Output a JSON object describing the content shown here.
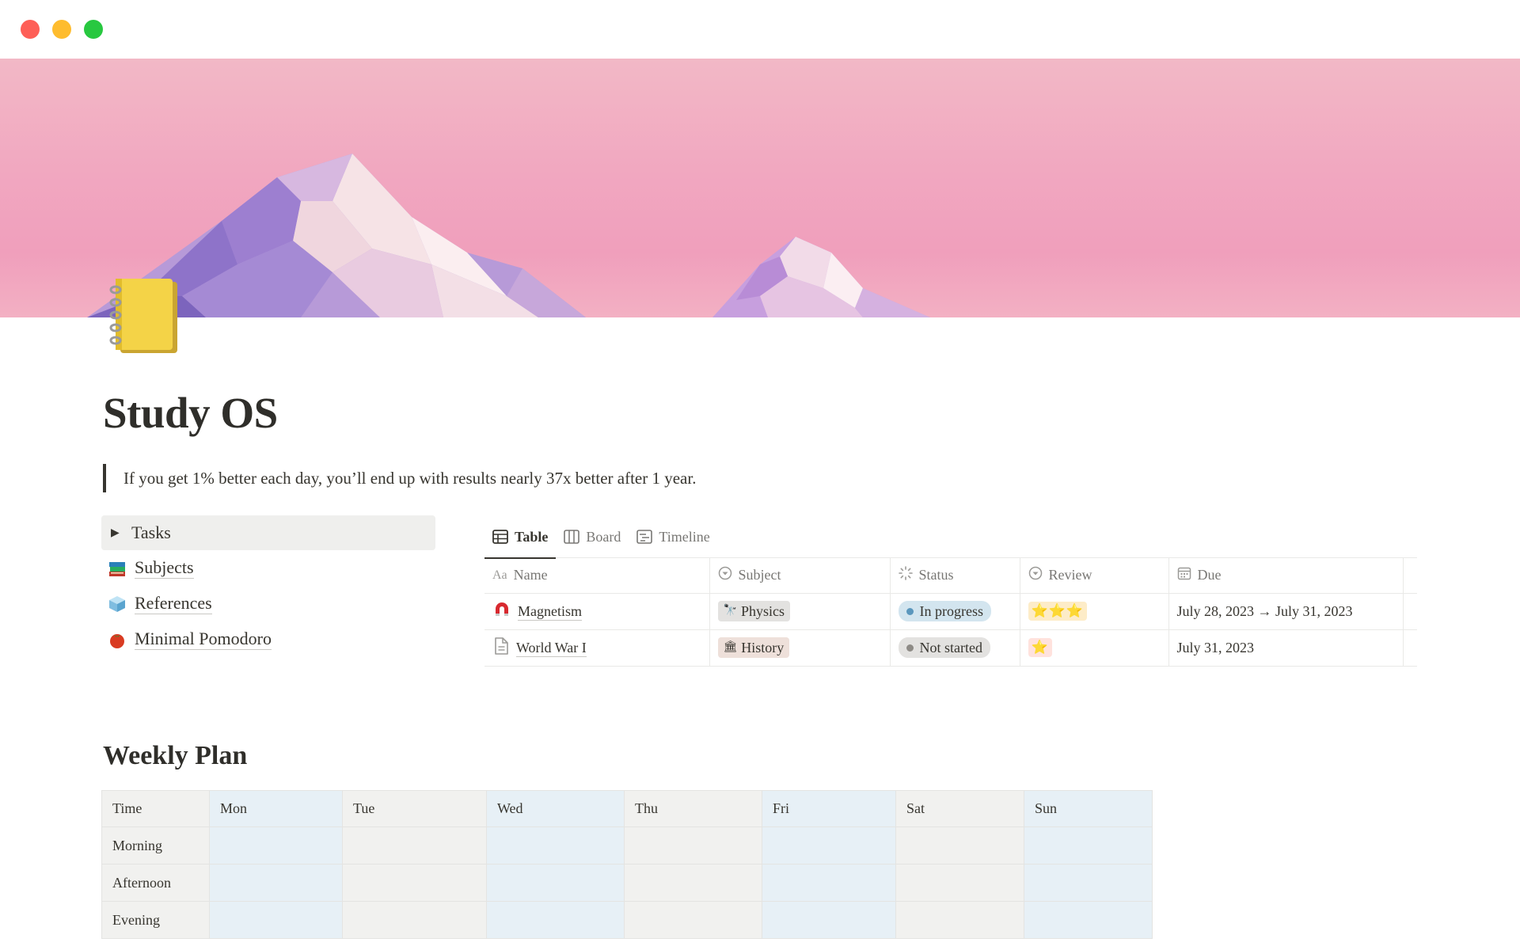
{
  "page": {
    "title": "Study OS",
    "icon": "notebook-icon",
    "quote": "If you get 1% better each day, you’ll end up with results nearly 37x better after 1 year."
  },
  "links": {
    "toggle": {
      "label": "Tasks",
      "icon": "triangle-right-icon"
    },
    "items": [
      {
        "label": "Subjects",
        "icon": "books-icon"
      },
      {
        "label": "References",
        "icon": "ice-cube-icon"
      },
      {
        "label": "Minimal Pomodoro",
        "icon": "tomato-icon"
      }
    ]
  },
  "database": {
    "views": [
      {
        "label": "Table",
        "icon": "table-icon",
        "active": true
      },
      {
        "label": "Board",
        "icon": "board-icon",
        "active": false
      },
      {
        "label": "Timeline",
        "icon": "timeline-icon",
        "active": false
      }
    ],
    "columns": [
      {
        "label": "Name",
        "icon": "text-icon"
      },
      {
        "label": "Subject",
        "icon": "select-icon"
      },
      {
        "label": "Status",
        "icon": "status-icon"
      },
      {
        "label": "Review",
        "icon": "select-icon"
      },
      {
        "label": "Due",
        "icon": "calendar-icon"
      }
    ],
    "rows": [
      {
        "name": "Magnetism",
        "icon": "magnet-icon",
        "subject": "Physics",
        "subject_icon": "telescope-icon",
        "status": "In progress",
        "review": "⭐⭐⭐",
        "due": "July 28, 2023 → July 31, 2023"
      },
      {
        "name": "World War I",
        "icon": "page-icon",
        "subject": "History",
        "subject_icon": "classical-building-icon",
        "status": "Not started",
        "review": "⭐",
        "due": "July 31, 2023"
      }
    ]
  },
  "weekly": {
    "title": "Weekly Plan",
    "header": [
      "Time",
      "Mon",
      "Tue",
      "Wed",
      "Thu",
      "Fri",
      "Sat",
      "Sun"
    ],
    "rows": [
      "Morning",
      "Afternoon",
      "Evening"
    ]
  },
  "colors": {
    "cover_pink": "#f1a7c0",
    "in_progress_bg": "#d3e5ef",
    "not_started_bg": "#e3e2e0",
    "weekday_blue": "#e7f0f6",
    "weekday_grey": "#f1f1ef"
  }
}
